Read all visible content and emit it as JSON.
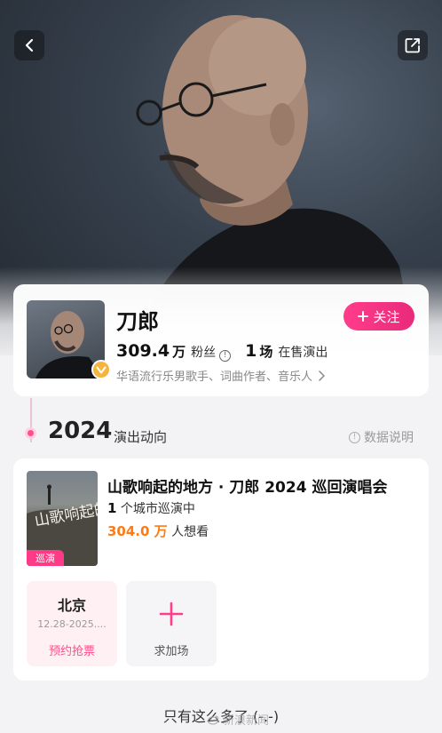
{
  "artist": {
    "name": "刀郎",
    "fans_count": "309.4",
    "fans_unit": "万",
    "fans_label": "粉丝",
    "shows_count": "1",
    "shows_unit": "场",
    "shows_label": "在售演出",
    "tags": "华语流行乐男歌手、词曲作者、音乐人",
    "follow_label": "关注"
  },
  "timeline": {
    "year": "2024",
    "subtitle": "演出动向",
    "data_note": "数据说明"
  },
  "tour": {
    "title": "山歌响起的地方 · 刀郎 2024 巡回演唱会",
    "cities_count": "1",
    "cities_text": "个城市巡演中",
    "want_count": "304.0 万",
    "want_text": "人想看",
    "poster_tag": "巡演",
    "poster_text": "山歌响起的地方"
  },
  "city": {
    "name": "北京",
    "date": "12.28-2025....",
    "status": "预约抢票"
  },
  "request_label": "求加场",
  "footer": "只有这么多了 (-.-)",
  "watermark": "新浪新闻",
  "colors": {
    "accent_pink": "#ff3d8b",
    "orange": "#ff7a12",
    "badge_gold": "#f4b43e"
  },
  "icons": {
    "back": "chevron-left-icon",
    "share": "share-icon",
    "info": "info-icon",
    "plus": "plus-icon"
  }
}
